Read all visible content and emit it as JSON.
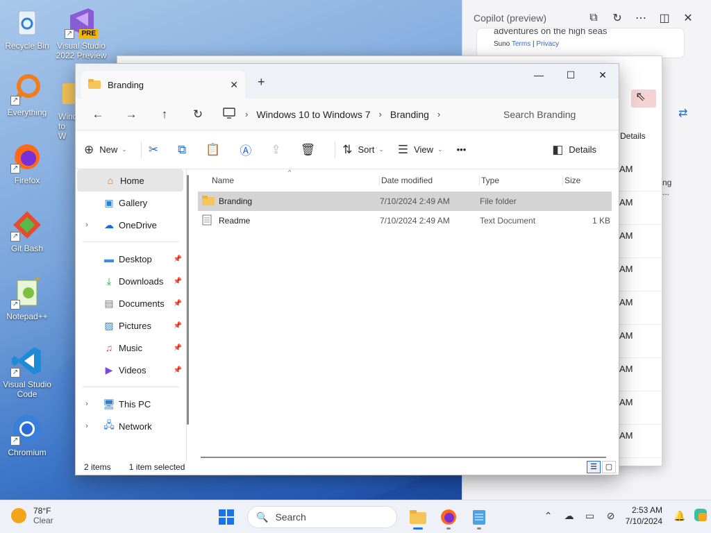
{
  "desktop": {
    "icons": [
      {
        "label": "Recycle Bin"
      },
      {
        "label": "Visual Studio 2022 Preview",
        "badge": "PRE"
      },
      {
        "label": "Everything"
      },
      {
        "label": "Wind to W"
      },
      {
        "label": "Firefox"
      },
      {
        "label": "Git Bash"
      },
      {
        "label": "Notepad++"
      },
      {
        "label": "Visual Studio Code"
      },
      {
        "label": "Chromium"
      }
    ]
  },
  "copilot": {
    "title": "Copilot (preview)",
    "card_title": "adventures on the high seas",
    "card_source": "Suno",
    "card_terms": "Terms",
    "card_sep": "|",
    "card_privacy": "Privacy"
  },
  "ghost": {
    "details_label": "Details",
    "times": [
      "AM",
      "AM",
      "AM",
      "AM",
      "AM",
      "AM",
      "AM",
      "AM",
      "AM"
    ],
    "snippet1": "ng",
    "snippet2": "..."
  },
  "explorer": {
    "tab_label": "Branding",
    "new_tab": "+",
    "breadcrumb": [
      "Windows 10 to Windows 7",
      "Branding"
    ],
    "search_placeholder": "Search Branding",
    "cmd": {
      "new": "New",
      "sort": "Sort",
      "view": "View",
      "more": "•••",
      "details": "Details"
    },
    "sidebar": {
      "top": [
        {
          "label": "Home",
          "icon": "home-icon"
        },
        {
          "label": "Gallery",
          "icon": "gallery-icon"
        },
        {
          "label": "OneDrive",
          "icon": "cloud-icon"
        }
      ],
      "pinned": [
        {
          "label": "Desktop",
          "icon": "desktop-icon"
        },
        {
          "label": "Downloads",
          "icon": "download-icon"
        },
        {
          "label": "Documents",
          "icon": "document-icon"
        },
        {
          "label": "Pictures",
          "icon": "pictures-icon"
        },
        {
          "label": "Music",
          "icon": "music-icon"
        },
        {
          "label": "Videos",
          "icon": "videos-icon"
        }
      ],
      "bottom": [
        {
          "label": "This PC",
          "icon": "pc-icon"
        },
        {
          "label": "Network",
          "icon": "network-icon"
        }
      ]
    },
    "columns": [
      "Name",
      "Date modified",
      "Type",
      "Size"
    ],
    "files": [
      {
        "name": "Branding",
        "date": "7/10/2024 2:49 AM",
        "type": "File folder",
        "size": "",
        "kind": "folder",
        "selected": true
      },
      {
        "name": "Readme",
        "date": "7/10/2024 2:49 AM",
        "type": "Text Document",
        "size": "1 KB",
        "kind": "text",
        "selected": false
      }
    ],
    "status": {
      "items": "2 items",
      "selected": "1 item selected"
    }
  },
  "taskbar": {
    "temp": "78°F",
    "weather": "Clear",
    "search_placeholder": "Search",
    "time": "2:53 AM",
    "date": "7/10/2024"
  }
}
